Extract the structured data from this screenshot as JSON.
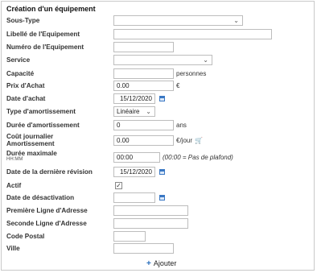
{
  "form": {
    "title": "Création d'un équipement",
    "fields": {
      "sous_type": {
        "label": "Sous-Type",
        "value": ""
      },
      "libelle": {
        "label": "Libellé de l'Equipement",
        "value": ""
      },
      "numero": {
        "label": "Numéro de l'Equipement",
        "value": ""
      },
      "service": {
        "label": "Service",
        "value": ""
      },
      "capacite": {
        "label": "Capacité",
        "value": "",
        "suffix": "personnes"
      },
      "prix_achat": {
        "label": "Prix d'Achat",
        "value": "0.00",
        "suffix": "€"
      },
      "date_achat": {
        "label": "Date d'achat",
        "value": "15/12/2020"
      },
      "type_amortissement": {
        "label": "Type d'amortissement",
        "value": "Linéaire"
      },
      "duree_amortissement": {
        "label": "Durée d'amortissement",
        "value": "0",
        "suffix": "ans"
      },
      "cout_journalier": {
        "label": "Coût journalier Amortissement",
        "value": "0.00",
        "suffix": "€/jour"
      },
      "duree_maximale": {
        "label": "Durée maximale",
        "sublabel": "HH:MM",
        "value": "00:00",
        "hint": "(00:00 = Pas de plafond)"
      },
      "date_revision": {
        "label": "Date de la dernière révision",
        "value": "15/12/2020"
      },
      "actif": {
        "label": "Actif",
        "checked": true
      },
      "date_desactivation": {
        "label": "Date de désactivation",
        "value": ""
      },
      "adresse1": {
        "label": "Première Ligne d'Adresse",
        "value": ""
      },
      "adresse2": {
        "label": "Seconde Ligne d'Adresse",
        "value": ""
      },
      "code_postal": {
        "label": "Code Postal",
        "value": ""
      },
      "ville": {
        "label": "Ville",
        "value": ""
      }
    },
    "add_button": {
      "label": "Ajouter"
    }
  },
  "icons": {
    "calendar": "calendar-icon",
    "cart": "cart-icon",
    "chevron": "chevron-down-icon",
    "plus": "plus-icon"
  },
  "colors": {
    "accent": "#2a6fbd"
  }
}
